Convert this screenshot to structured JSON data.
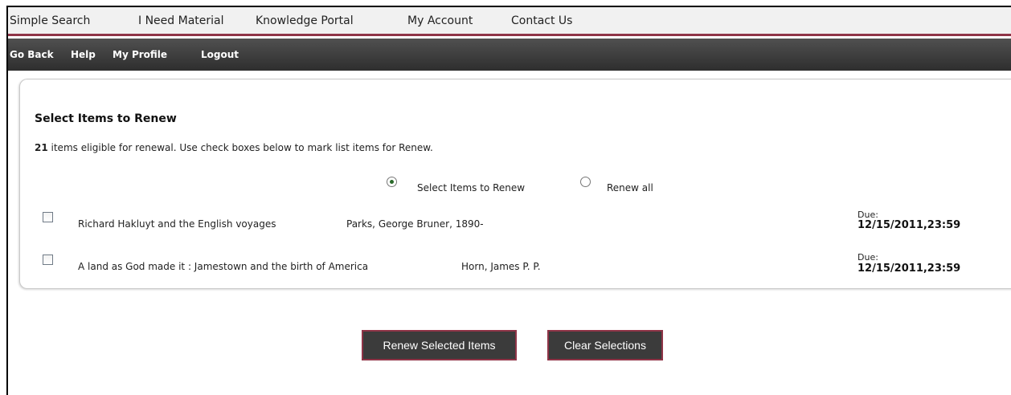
{
  "top_nav": {
    "items": [
      "Simple Search",
      "I Need Material",
      "Knowledge Portal",
      "My Account",
      "Contact Us"
    ]
  },
  "sub_nav": {
    "items": [
      "Go Back",
      "Help",
      "My Profile",
      "Logout"
    ]
  },
  "renew": {
    "heading": "Select Items to Renew",
    "eligible_count": "21",
    "eligible_text": " items eligible for renewal. Use check boxes below to mark list items for Renew.",
    "mode_options": [
      {
        "label": "Select Items to Renew",
        "selected": true
      },
      {
        "label": "Renew all",
        "selected": false
      }
    ],
    "items": [
      {
        "title": "Richard Hakluyt and the English voyages",
        "author": "Parks, George Bruner, 1890-",
        "due_label": "Due:",
        "due_date": "12/15/2011,23:59",
        "checked": false
      },
      {
        "title": "A land as God made it : Jamestown and the birth of America",
        "author": "Horn, James P. P.",
        "due_label": "Due:",
        "due_date": "12/15/2011,23:59",
        "checked": false
      }
    ],
    "buttons": {
      "renew_selected": "Renew Selected Items",
      "clear_selections": "Clear Selections"
    }
  }
}
